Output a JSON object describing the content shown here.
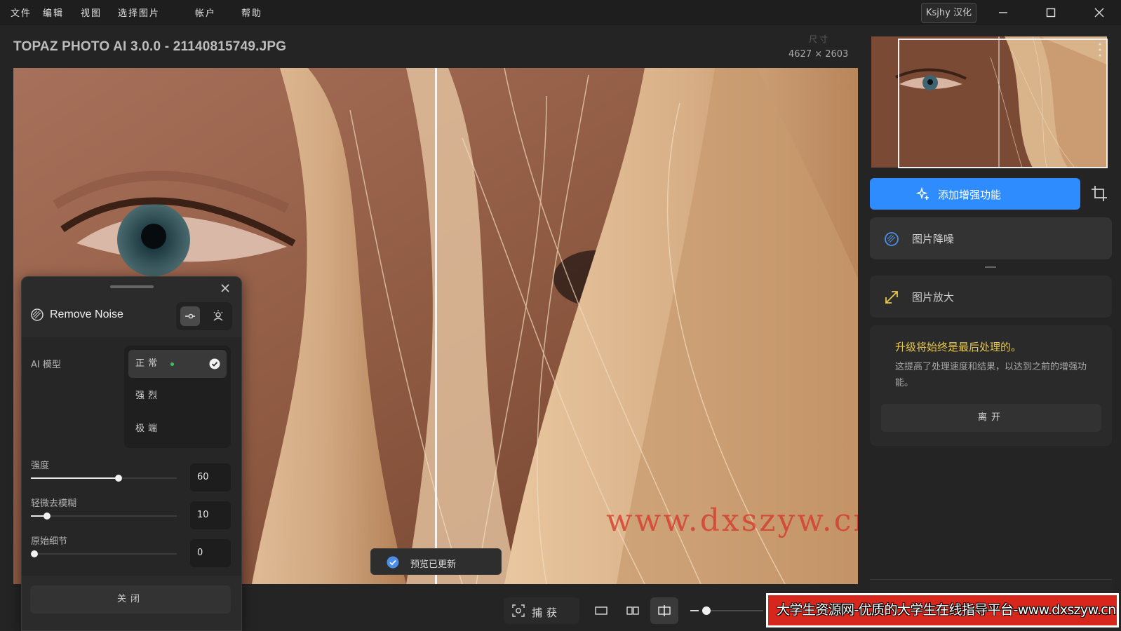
{
  "menu": [
    "文件",
    "编辑",
    "视图",
    "选择图片",
    "帐户",
    "帮助"
  ],
  "localization_badge": "Ksjhy 汉化",
  "window_title": "TOPAZ PHOTO AI 3.0.0 - 21140815749.JPG",
  "image_info": {
    "dimension_label": "尺寸",
    "dimension_value": "4627 × 2603"
  },
  "watermark": "www.dxszyw.cn",
  "panel": {
    "title": "Remove Noise",
    "ai_model_label": "AI 模型",
    "models": [
      "正常",
      "强烈",
      "极端"
    ],
    "selected_model": "正常",
    "sliders": [
      {
        "label": "强度",
        "value": "60",
        "fraction": 0.6
      },
      {
        "label": "轻微去模糊",
        "value": "10",
        "fraction": 0.1
      },
      {
        "label": "原始细节",
        "value": "0",
        "fraction": 0.0
      }
    ],
    "close_label": "关闭"
  },
  "toast": "预览已更新",
  "toolbar": {
    "capture_label": "捕获"
  },
  "sidebar": {
    "add_enhancement_label": "添加增强功能",
    "tools": [
      "图片降噪",
      "图片放大"
    ],
    "info_title": "升级将始终是最后处理的。",
    "info_body": "这提高了处理速度和结果，以达到之前的增强功能。",
    "leave_label": "离开"
  },
  "banner": "大学生资源网-优质的大学生在线指导平台-www.dxszyw.cn",
  "colors": {
    "accent": "#2f8cff",
    "warning_text": "#e8c84a",
    "banner_bg": "#d7261c",
    "ok_green": "#3cc45a"
  },
  "icons": [
    "minimize-icon",
    "maximize-icon",
    "window-close-icon",
    "remove-noise-icon",
    "manual-mode-icon",
    "auto-mode-icon",
    "check-icon",
    "capture-icon",
    "crop-icon",
    "sparkle-add-icon",
    "denoise-icon",
    "upscale-icon"
  ]
}
